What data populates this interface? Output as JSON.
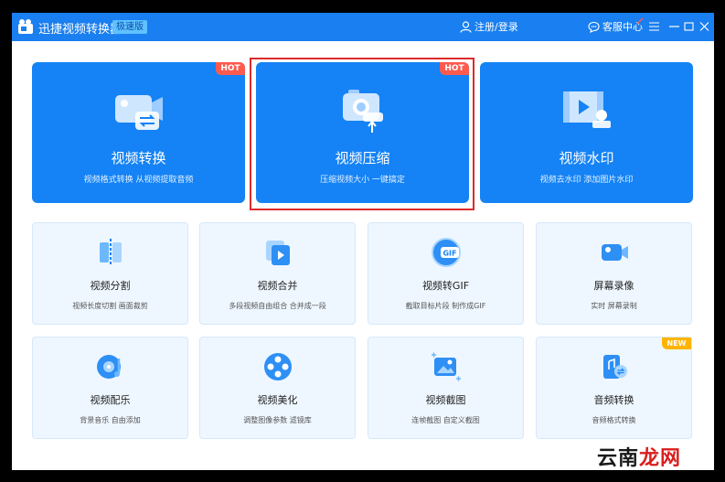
{
  "app": {
    "title": "迅捷视频转换器",
    "edition": "极速版"
  },
  "header": {
    "login_label": "注册/登录",
    "service_label": "客服中心"
  },
  "big_cards": [
    {
      "title": "视频转换",
      "desc": "视频格式转换 从视频提取音频",
      "badge": "HOT"
    },
    {
      "title": "视频压缩",
      "desc": "压缩视频大小 一键搞定",
      "badge": "HOT"
    },
    {
      "title": "视频水印",
      "desc": "视频去水印 添加图片水印"
    }
  ],
  "small_cards": [
    {
      "title": "视频分割",
      "desc": "视频长度切割 画面裁剪"
    },
    {
      "title": "视频合并",
      "desc": "多段视频自由组合 合并成一段"
    },
    {
      "title": "视频转GIF",
      "desc": "截取目标片段 制作成GIF"
    },
    {
      "title": "屏幕录像",
      "desc": "实时 屏幕录制"
    },
    {
      "title": "视频配乐",
      "desc": "背景音乐 自由添加"
    },
    {
      "title": "视频美化",
      "desc": "调整图像参数 滤镜库"
    },
    {
      "title": "视频截图",
      "desc": "连帧截图 自定义截图"
    },
    {
      "title": "音频转换",
      "desc": "音频格式转换",
      "badge": "NEW"
    }
  ],
  "watermark": {
    "part1": "云南",
    "part2": "龙网"
  },
  "colors": {
    "brand": "#1a7ff0",
    "card_blue": "#1583f5",
    "hot": "#ff5a4e",
    "new": "#ffb400",
    "selection": "#dd2b2b"
  }
}
